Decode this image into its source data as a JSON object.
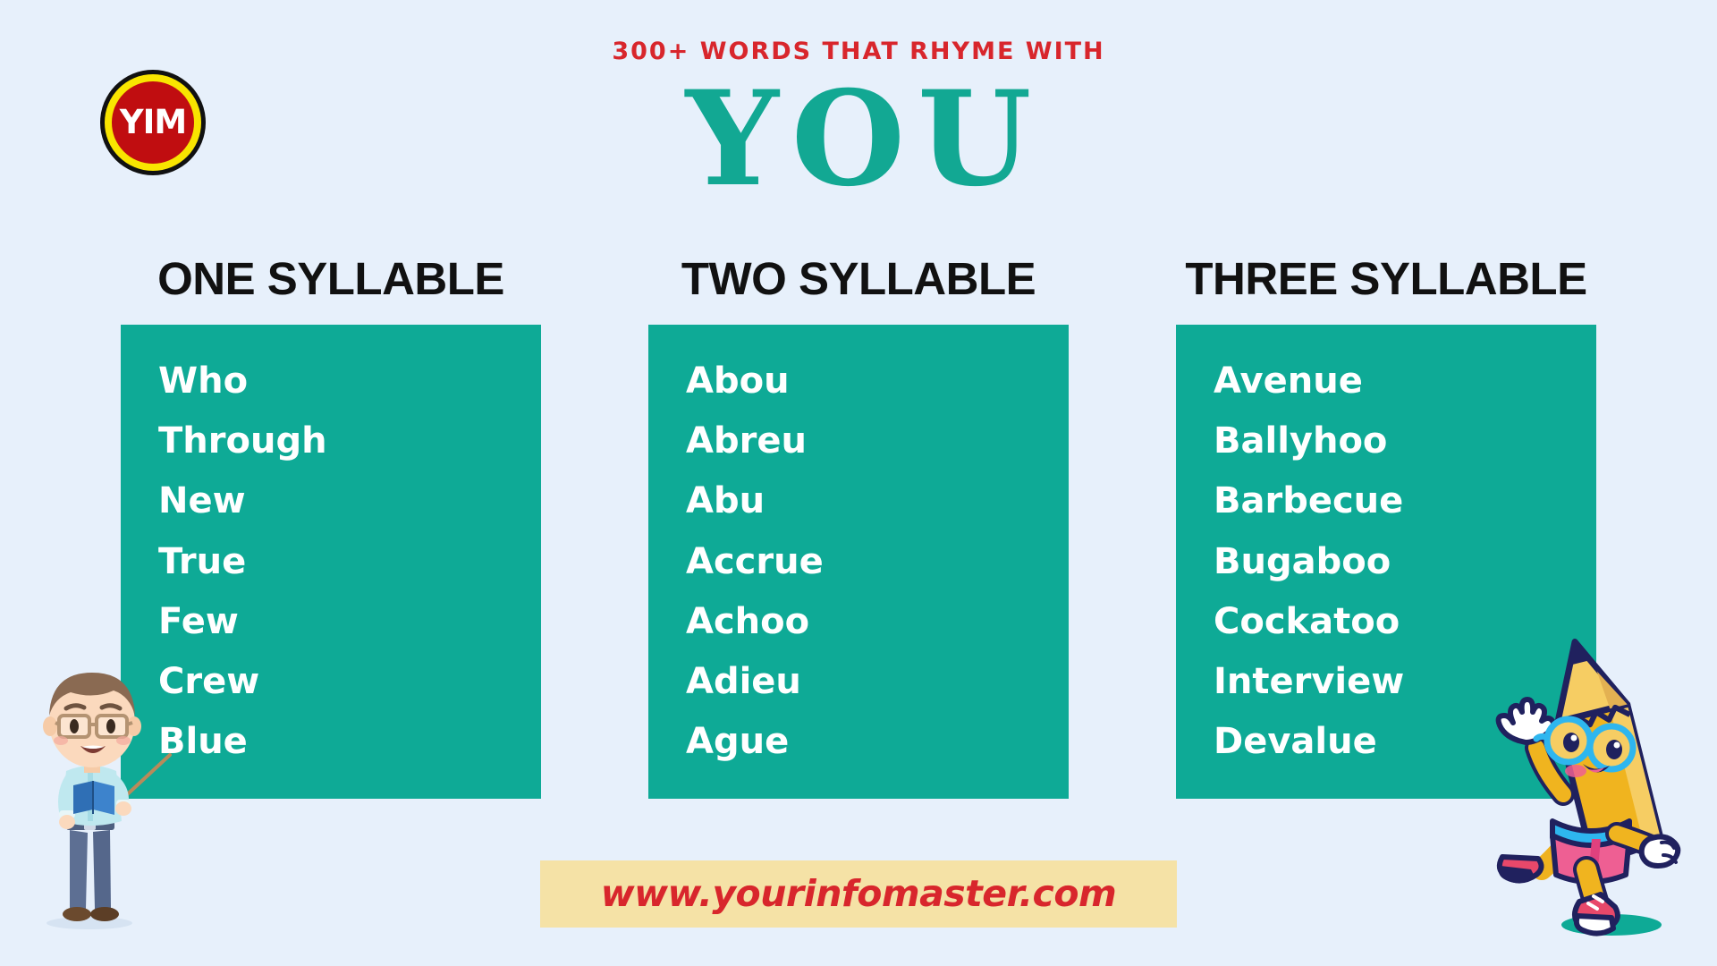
{
  "brand": {
    "logo_text": "YIM"
  },
  "header": {
    "kicker": "300+ WORDS THAT RHYME WITH",
    "big_word": "YOU"
  },
  "columns": [
    {
      "heading": "ONE SYLLABLE",
      "words": [
        "Who",
        "Through",
        "New",
        "True",
        "Few",
        "Crew",
        "Blue"
      ]
    },
    {
      "heading": "TWO SYLLABLE",
      "words": [
        "Abou",
        "Abreu",
        "Abu",
        "Accrue",
        "Achoo",
        "Adieu",
        "Ague"
      ]
    },
    {
      "heading": "THREE SYLLABLE",
      "words": [
        "Avenue",
        "Ballyhoo",
        "Barbecue",
        "Bugaboo",
        "Cockatoo",
        "Interview",
        "Devalue"
      ]
    }
  ],
  "footer": {
    "url": "www.yourinfomaster.com"
  },
  "colors": {
    "background": "#e7f0fb",
    "teal": "#0eaa96",
    "title_teal": "#12a893",
    "red": "#d8262c",
    "banner": "#f5e2a6",
    "logo_red": "#c00d10",
    "logo_yellow": "#f9e500",
    "heading_black": "#111111",
    "word_white": "#ffffff"
  },
  "mascots": {
    "left": "teacher-character",
    "right": "pencil-character"
  }
}
